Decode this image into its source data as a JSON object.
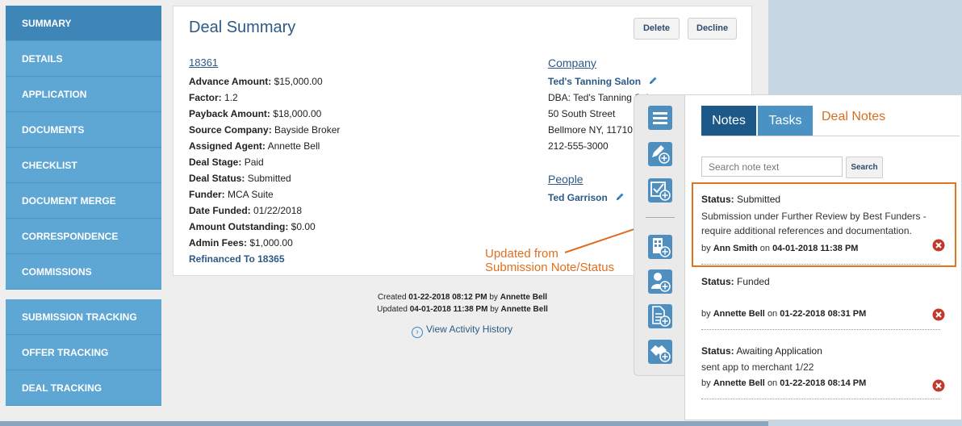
{
  "sidebar": {
    "items": [
      "SUMMARY",
      "DETAILS",
      "APPLICATION",
      "DOCUMENTS",
      "CHECKLIST",
      "DOCUMENT MERGE",
      "CORRESPONDENCE",
      "COMMISSIONS"
    ],
    "items2": [
      "SUBMISSION TRACKING",
      "OFFER TRACKING",
      "DEAL TRACKING"
    ]
  },
  "summary": {
    "title": "Deal Summary",
    "delete_label": "Delete",
    "decline_label": "Decline",
    "deal_id": "18361",
    "fields": [
      {
        "label": "Advance Amount:",
        "value": "$15,000.00"
      },
      {
        "label": "Factor:",
        "value": "1.2"
      },
      {
        "label": "Payback Amount:",
        "value": "$18,000.00"
      },
      {
        "label": "Source Company:",
        "value": "Bayside Broker"
      },
      {
        "label": "Assigned Agent:",
        "value": "Annette Bell"
      },
      {
        "label": "Deal Stage:",
        "value": "Paid"
      },
      {
        "label": "Deal Status:",
        "value": "Submitted"
      },
      {
        "label": "Funder:",
        "value": "MCA Suite"
      },
      {
        "label": "Date Funded:",
        "value": "01/22/2018"
      },
      {
        "label": "Amount Outstanding:",
        "value": "$0.00"
      },
      {
        "label": "Admin Fees:",
        "value": "$1,000.00"
      }
    ],
    "refinanced": "Refinanced To 18365",
    "company": {
      "heading": "Company",
      "name": "Ted's Tanning Salon",
      "dba": "DBA: Ted's Tanning Salon",
      "address": "50 South Street",
      "city": "Bellmore NY, 11710",
      "phone": "212-555-3000"
    },
    "people": {
      "heading": "People",
      "name": "Ted Garrison"
    }
  },
  "meta": {
    "created_prefix": "Created",
    "created_date": "01-22-2018 08:12 PM",
    "created_by_word": "by",
    "created_by": "Annette Bell",
    "updated_prefix": "Updated",
    "updated_date": "04-01-2018 11:38 PM",
    "updated_by_word": "by",
    "updated_by": "Annette Bell",
    "activity_link": "View Activity History"
  },
  "annotation": {
    "line1": "Updated from",
    "line2": "Submission Note/Status"
  },
  "notes_panel": {
    "tab_notes": "Notes",
    "tab_tasks": "Tasks",
    "title": "Deal Notes",
    "search_placeholder": "Search note text",
    "search_button": "Search",
    "notes": [
      {
        "status_label": "Status:",
        "status": "Submitted",
        "text": "Submission under Further Review by Best Funders - require additional references and documentation.",
        "by_word": "by",
        "author": "Ann Smith",
        "on_word": "on",
        "date": "04-01-2018 11:38 PM"
      },
      {
        "status_label": "Status:",
        "status": "Funded",
        "text": "",
        "by_word": "by",
        "author": "Annette Bell",
        "on_word": "on",
        "date": "01-22-2018 08:31 PM"
      },
      {
        "status_label": "Status:",
        "status": "Awaiting Application",
        "text": "sent app to merchant 1/22",
        "by_word": "by",
        "author": "Annette Bell",
        "on_word": "on",
        "date": "01-22-2018 08:14 PM"
      }
    ]
  },
  "colors": {
    "accent": "#2c5a86",
    "sidebar": "#5ea7d4",
    "annotation": "#de6f1f"
  }
}
